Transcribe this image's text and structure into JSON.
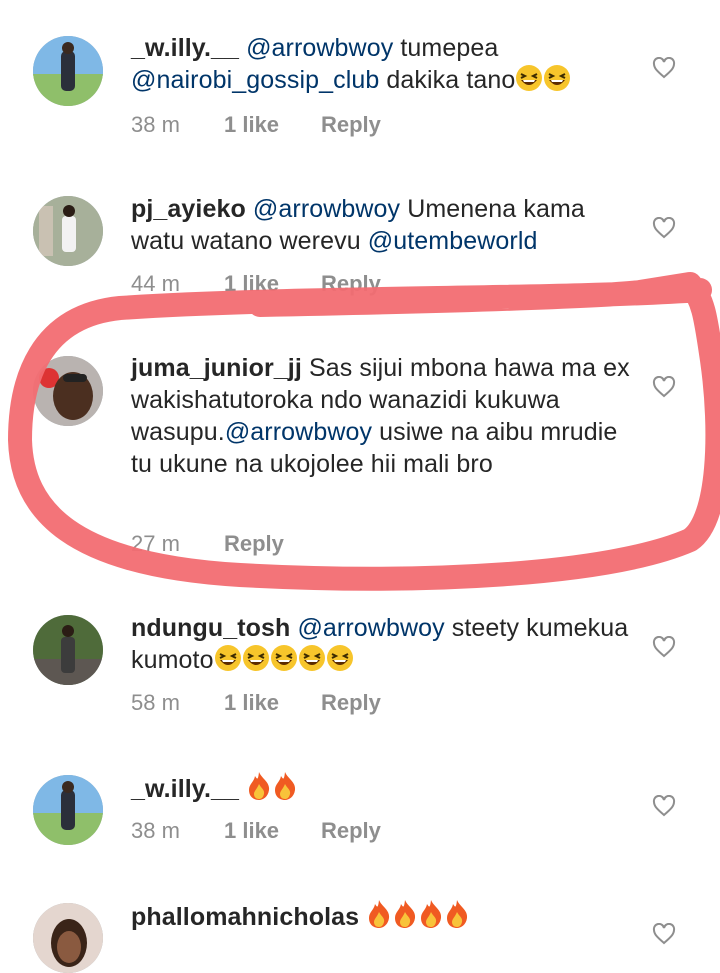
{
  "colors": {
    "mention": "#003569",
    "meta": "#8e8e8e",
    "annotation": "#f26d72"
  },
  "comments": [
    {
      "username": "_w.illy.__",
      "parts": [
        {
          "t": "mention",
          "v": "@arrowbwoy"
        },
        {
          "t": "text",
          "v": " tumepea "
        },
        {
          "t": "mention",
          "v": "@nairobi_gossip_club"
        },
        {
          "t": "text",
          "v": " dakika tano"
        },
        {
          "t": "emoji",
          "v": "grinning-squinting-face"
        },
        {
          "t": "emoji",
          "v": "grinning-squinting-face"
        }
      ],
      "time": "38 m",
      "likes": "1 like",
      "reply": "Reply"
    },
    {
      "username": "pj_ayieko",
      "parts": [
        {
          "t": "mention",
          "v": "@arrowbwoy"
        },
        {
          "t": "text",
          "v": " Umenena kama watu watano werevu "
        },
        {
          "t": "mention",
          "v": "@utembeworld"
        }
      ],
      "time": "44 m",
      "likes": "1 like",
      "reply": "Reply"
    },
    {
      "username": "juma_junior_jj",
      "parts": [
        {
          "t": "text",
          "v": " Sas sijui mbona hawa ma ex wakishatutoroka ndo wanazidi kukuwa wasupu."
        },
        {
          "t": "mention",
          "v": "@arrowbwoy"
        },
        {
          "t": "text",
          "v": "  usiwe na aibu mrudie tu ukune na ukojolee hii mali bro"
        }
      ],
      "time": "27 m",
      "likes": "",
      "reply": "Reply"
    },
    {
      "username": "ndungu_tosh",
      "parts": [
        {
          "t": "mention",
          "v": "@arrowbwoy"
        },
        {
          "t": "text",
          "v": " steety kumekua kumoto"
        },
        {
          "t": "emoji",
          "v": "grinning-squinting-face"
        },
        {
          "t": "emoji",
          "v": "grinning-squinting-face"
        },
        {
          "t": "emoji",
          "v": "grinning-squinting-face"
        },
        {
          "t": "emoji",
          "v": "grinning-squinting-face"
        },
        {
          "t": "emoji",
          "v": "grinning-squinting-face"
        }
      ],
      "time": "58 m",
      "likes": "1 like",
      "reply": "Reply"
    },
    {
      "username": "_w.illy.__",
      "parts": [
        {
          "t": "text",
          "v": " "
        },
        {
          "t": "emoji",
          "v": "fire"
        },
        {
          "t": "emoji",
          "v": "fire"
        }
      ],
      "time": "38 m",
      "likes": "1 like",
      "reply": "Reply"
    },
    {
      "username": "phallomahnicholas",
      "parts": [
        {
          "t": "text",
          "v": " "
        },
        {
          "t": "emoji",
          "v": "fire"
        },
        {
          "t": "emoji",
          "v": "fire"
        },
        {
          "t": "emoji",
          "v": "fire"
        },
        {
          "t": "emoji",
          "v": "fire"
        }
      ],
      "time": "",
      "likes": "",
      "reply": ""
    }
  ]
}
